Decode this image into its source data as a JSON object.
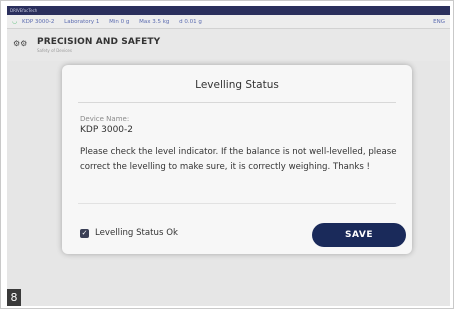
{
  "titlebar": {
    "text": "DRIVEfacTech"
  },
  "statusbar": {
    "items": [
      "KDP 3000-2",
      "Laboratory 1",
      "Min 0 g",
      "Max 3.5 kg",
      "d 0.01 g"
    ],
    "lang": "ENG"
  },
  "header": {
    "title": "PRECISION AND SAFETY",
    "subtitle": "Safety of Devices"
  },
  "dialog": {
    "title": "Levelling Status",
    "device_label": "Device Name:",
    "device_name": "KDP 3000-2",
    "message": "Please check the level indicator. If the balance is not well-levelled, please correct the levelling to make sure, it is correctly weighing. Thanks !",
    "checkbox_label": "Levelling Status Ok",
    "checkbox_checked": true,
    "save_label": "SAVE"
  },
  "figure_number": "8",
  "colors": {
    "primary": "#1a2a5a",
    "titlebar": "#2a2f5c",
    "wifi": "#34b15a"
  }
}
